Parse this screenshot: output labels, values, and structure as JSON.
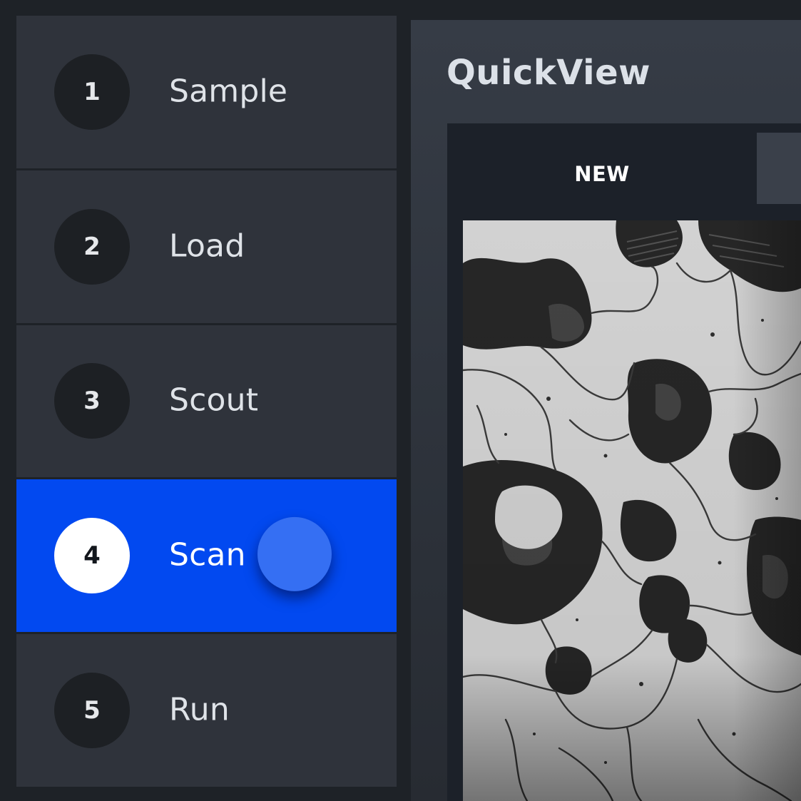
{
  "sidebar": {
    "steps": [
      {
        "number": "1",
        "label": "Sample",
        "active": false
      },
      {
        "number": "2",
        "label": "Load",
        "active": false
      },
      {
        "number": "3",
        "label": "Scout",
        "active": false
      },
      {
        "number": "4",
        "label": "Scan",
        "active": true
      },
      {
        "number": "5",
        "label": "Run",
        "active": false
      }
    ]
  },
  "main": {
    "title": "QuickView",
    "tabs": [
      {
        "label": "NEW",
        "active": true
      },
      {
        "label": "",
        "active": false
      }
    ]
  },
  "colors": {
    "background": "#1e2227",
    "step_background": "#2f333b",
    "accent": "#0249f0",
    "touch_indicator": "#356ff3",
    "viewer_background": "#1c2129"
  }
}
